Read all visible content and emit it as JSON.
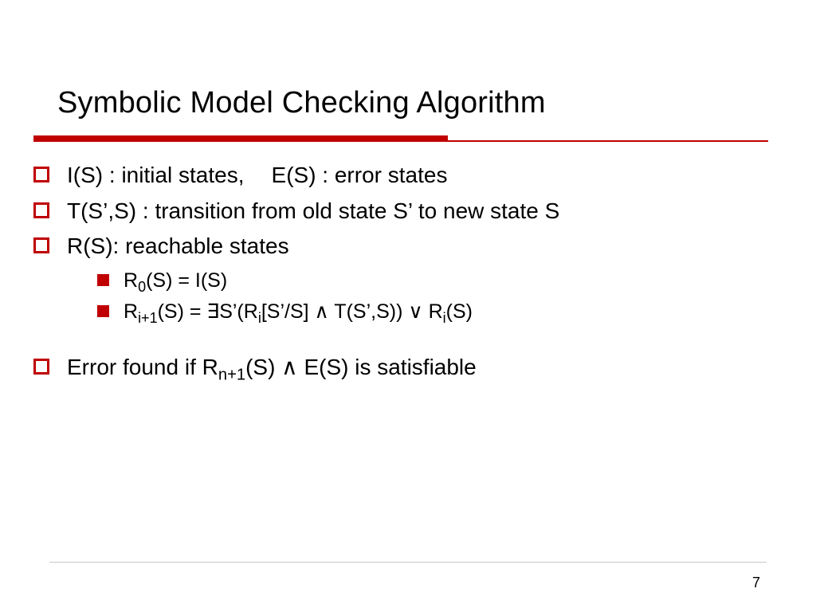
{
  "title": "Symbolic Model Checking Algorithm",
  "bullets": {
    "b1_pre": "I(S) : initial states,",
    "b1_post": "E(S) : error states",
    "b2": "T(S’,S) : transition from old state S’ to new state S",
    "b3": "R(S): reachable states",
    "s1_a": "R",
    "s1_sub": "0",
    "s1_b": "(S) = I(S)",
    "s2_a": "R",
    "s2_sub1": "i+1",
    "s2_b": "(S) = ∃S’(R",
    "s2_sub2": "i",
    "s2_c": "[S’/S] ∧ T(S’,S)) ∨ R",
    "s2_sub3": "i",
    "s2_d": "(S)",
    "b4_a": "Error found if R",
    "b4_sub": "n+1",
    "b4_b": "(S) ∧ E(S) is satisfiable"
  },
  "page": "7",
  "colors": {
    "accent": "#c00000"
  }
}
